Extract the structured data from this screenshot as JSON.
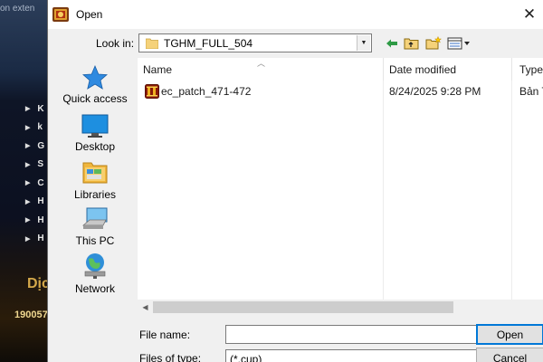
{
  "background": {
    "top_text": "on exten",
    "menu_items": [
      "K",
      "k",
      "G",
      "S",
      "C",
      "H",
      "H",
      "H"
    ],
    "promo_text": "Dịc",
    "phone_text": "190057"
  },
  "dialog": {
    "title": "Open",
    "close_glyph": "✕",
    "look_in_label": "Look in:",
    "look_in_value": "TGHM_FULL_504",
    "places": [
      {
        "label": "Quick access",
        "icon": "star-icon"
      },
      {
        "label": "Desktop",
        "icon": "desktop-icon"
      },
      {
        "label": "Libraries",
        "icon": "libraries-icon"
      },
      {
        "label": "This PC",
        "icon": "computer-icon"
      },
      {
        "label": "Network",
        "icon": "network-icon"
      }
    ],
    "columns": {
      "name": "Name",
      "date": "Date modified",
      "type": "Type"
    },
    "files": [
      {
        "name": "ec_patch_471-472",
        "date": "8/24/2025 9:28 PM",
        "type": "Bản T"
      }
    ],
    "file_name_label": "File name:",
    "file_name_value": "",
    "files_of_type_label": "Files of type:",
    "files_of_type_value": "(*.cup)",
    "open_label": "Open",
    "cancel_label": "Cancel"
  }
}
